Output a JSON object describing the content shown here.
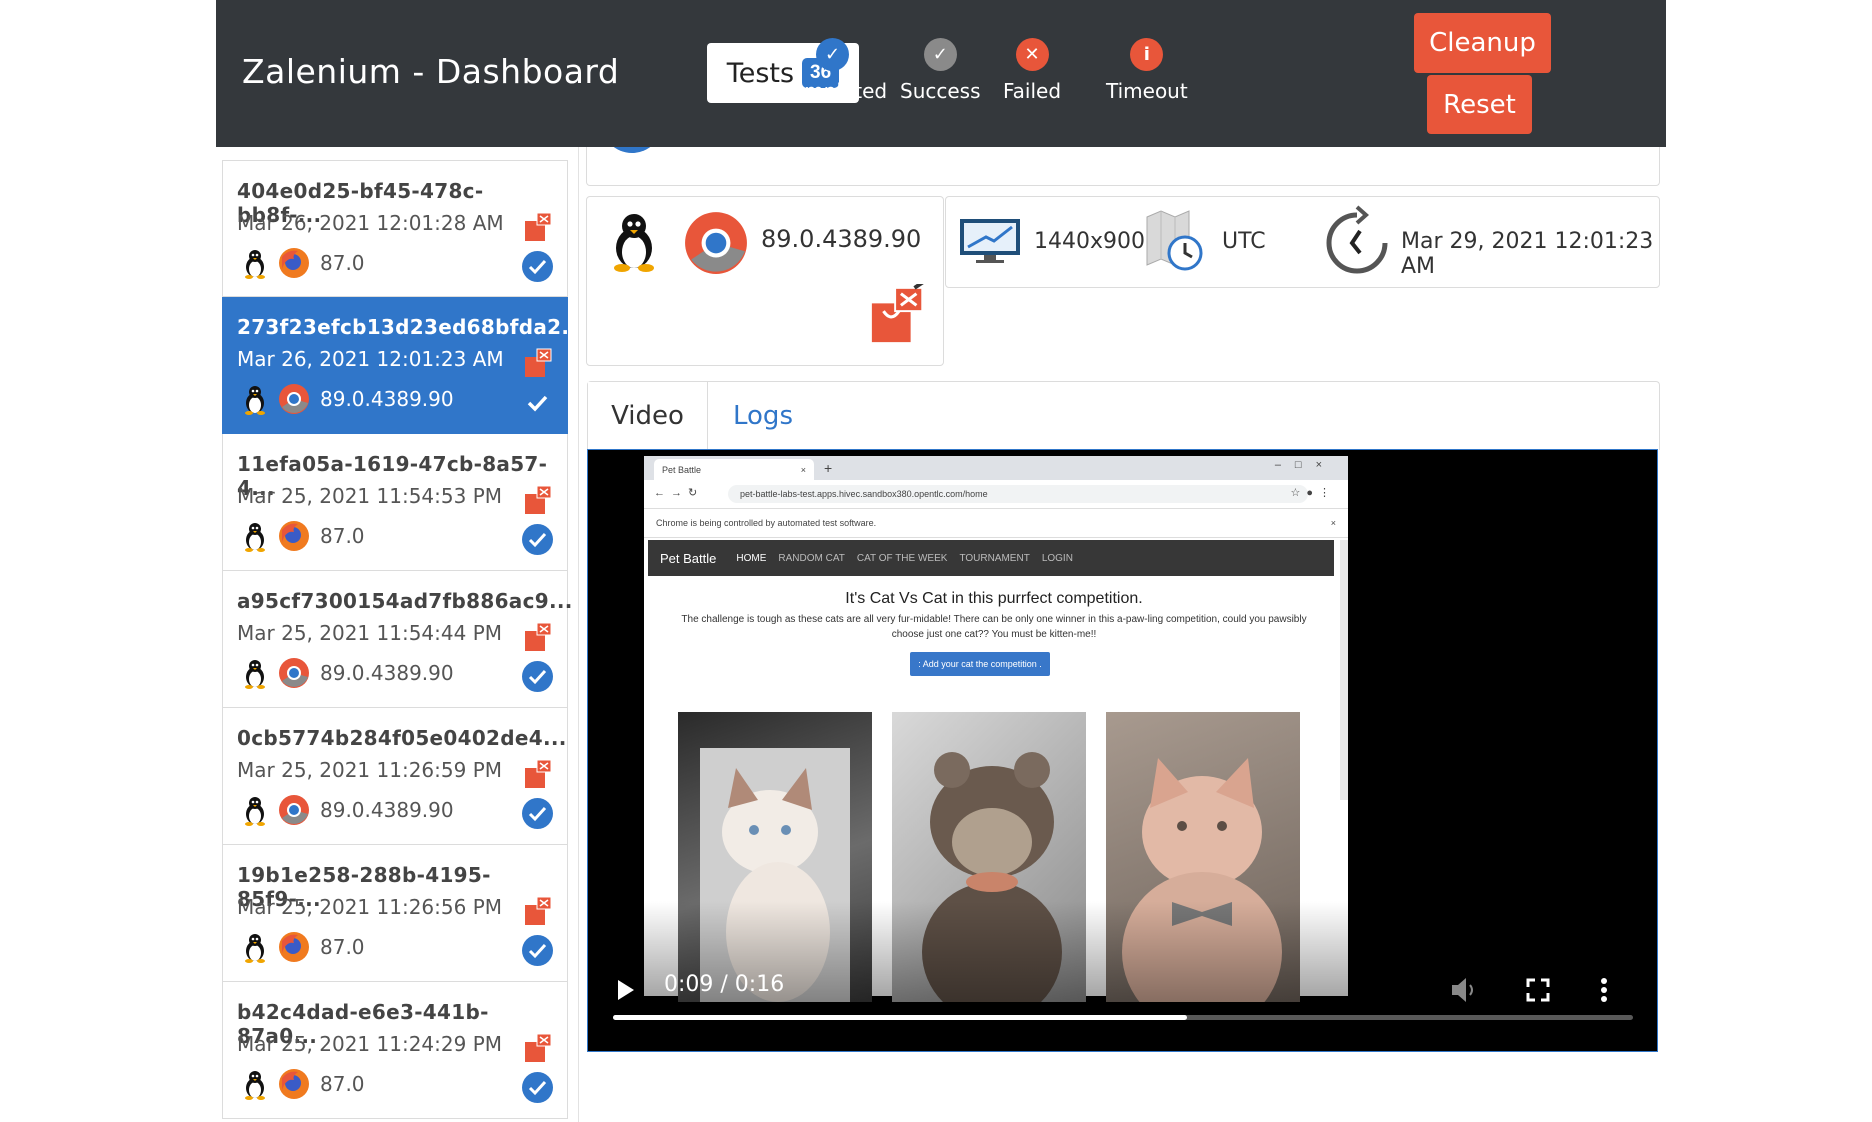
{
  "header": {
    "title": "Zalenium - Dashboard",
    "tests_label": "Tests",
    "tests_count": "36",
    "statuses": [
      {
        "label": "Completed",
        "color": "#3076c9",
        "icon": "check-icon"
      },
      {
        "label": "Success",
        "color": "#8a8a8a",
        "icon": "check-icon"
      },
      {
        "label": "Failed",
        "color": "#e8563a",
        "icon": "cross-icon"
      },
      {
        "label": "Timeout",
        "color": "#e8563a",
        "icon": "info-icon"
      }
    ],
    "cleanup_label": "Cleanup",
    "reset_label": "Reset"
  },
  "sidebar": {
    "items": [
      {
        "id": "404e0d25-bf45-478c-bb8f-...",
        "date": "Mar 26, 2021 12:01:28 AM",
        "browser": "firefox",
        "version": "87.0",
        "active": false
      },
      {
        "id": "273f23efcb13d23ed68bfda2...",
        "date": "Mar 26, 2021 12:01:23 AM",
        "browser": "chrome",
        "version": "89.0.4389.90",
        "active": true
      },
      {
        "id": "11efa05a-1619-47cb-8a57-4...",
        "date": "Mar 25, 2021 11:54:53 PM",
        "browser": "firefox",
        "version": "87.0",
        "active": false
      },
      {
        "id": "a95cf7300154ad7fb886ac9...",
        "date": "Mar 25, 2021 11:54:44 PM",
        "browser": "chrome",
        "version": "89.0.4389.90",
        "active": false
      },
      {
        "id": "0cb5774b284f05e0402de4...",
        "date": "Mar 25, 2021 11:26:59 PM",
        "browser": "chrome",
        "version": "89.0.4389.90",
        "active": false
      },
      {
        "id": "19b1e258-288b-4195-85f9-...",
        "date": "Mar 25, 2021 11:26:56 PM",
        "browser": "firefox",
        "version": "87.0",
        "active": false
      },
      {
        "id": "b42c4dad-e6e3-441b-87a0...",
        "date": "Mar 25, 2021 11:24:29 PM",
        "browser": "firefox",
        "version": "87.0",
        "active": false
      }
    ]
  },
  "details": {
    "browser_version": "89.0.4389.90",
    "resolution": "1440x900",
    "timezone": "UTC",
    "retention_date": "Mar 29, 2021 12:01:23 AM"
  },
  "tabs": [
    {
      "label": "Video",
      "active": true
    },
    {
      "label": "Logs",
      "active": false
    }
  ],
  "video": {
    "time": "0:09 / 0:16",
    "progress": 0.5625,
    "browser_tab_title": "Pet Battle",
    "url": "pet-battle-labs-test.apps.hivec.sandbox380.opentlc.com/home",
    "infobar": "Chrome is being controlled by automated test software.",
    "app_brand": "Pet Battle",
    "nav_items": [
      "HOME",
      "RANDOM CAT",
      "CAT OF THE WEEK",
      "TOURNAMENT",
      "LOGIN"
    ],
    "page_title": "It's Cat Vs Cat in this purrfect competition.",
    "page_description": "The challenge is tough as these cats are all very fur-midable! There can be only one winner in this a-paw-ling competition, could you pawsibly choose just one cat?? You must be kitten-me!!",
    "page_button": ": Add your cat the competition ."
  },
  "colors": {
    "header_bg": "#34383c",
    "primary": "#3076c9",
    "danger": "#e8563a"
  }
}
